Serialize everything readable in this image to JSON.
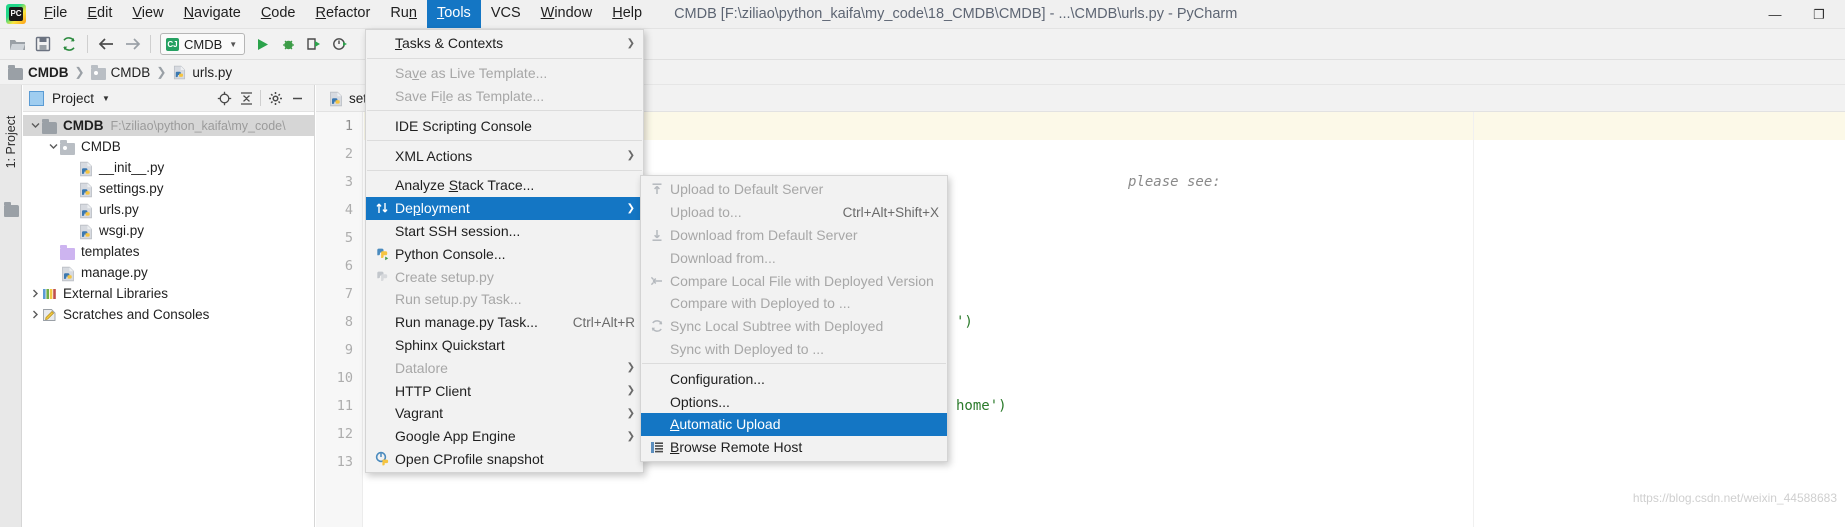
{
  "app": {
    "logo_icon": "pycharm-logo-icon",
    "window_title": "CMDB [F:\\ziliao\\python_kaifa\\my_code\\18_CMDB\\CMDB] - ...\\CMDB\\urls.py - PyCharm",
    "window_controls": {
      "minimize": "—",
      "maximize": "❐",
      "close": "✕"
    }
  },
  "menubar": {
    "items": [
      {
        "label": "File",
        "mnemonic": "F",
        "active": false
      },
      {
        "label": "Edit",
        "mnemonic": "E",
        "active": false
      },
      {
        "label": "View",
        "mnemonic": "V",
        "active": false
      },
      {
        "label": "Navigate",
        "mnemonic": "N",
        "active": false
      },
      {
        "label": "Code",
        "mnemonic": "C",
        "active": false
      },
      {
        "label": "Refactor",
        "mnemonic": "R",
        "active": false
      },
      {
        "label": "Run",
        "mnemonic": "n",
        "active": false
      },
      {
        "label": "Tools",
        "mnemonic": "T",
        "active": true
      },
      {
        "label": "VCS",
        "mnemonic": "",
        "active": false
      },
      {
        "label": "Window",
        "mnemonic": "W",
        "active": false
      },
      {
        "label": "Help",
        "mnemonic": "H",
        "active": false
      }
    ]
  },
  "toolbar": {
    "icons": [
      "open-folder-icon",
      "save-all-icon",
      "sync-refresh-icon",
      "back-arrow-icon",
      "forward-arrow-icon"
    ],
    "run_config": {
      "label": "CMDB",
      "chip": "CJ",
      "dropdown_icon": "chevron-down-icon"
    },
    "right_icons": [
      "run-icon",
      "debug-icon",
      "run-with-coverage-icon",
      "profile-icon"
    ]
  },
  "breadcrumb": {
    "items": [
      {
        "label": "CMDB",
        "icon": "folder-icon",
        "bold": true
      },
      {
        "label": "CMDB",
        "icon": "folder-open-icon",
        "bold": false
      },
      {
        "label": "urls.py",
        "icon": "python-file-icon",
        "bold": false
      }
    ],
    "separator": "❯"
  },
  "left_strip": {
    "tool_window_label": "1: Project",
    "mnemonic": "1",
    "folder_icon": "folder-icon"
  },
  "project_panel": {
    "header": {
      "title": "Project",
      "view_icon": "project-view-icon",
      "dropdown_icon": "chevron-down-icon",
      "locate_icon": "target-crosshair-icon",
      "collapse_icon": "collapse-all-icon",
      "settings_icon": "gear-icon",
      "hide_icon": "minimize-icon"
    },
    "tree": [
      {
        "label": "CMDB",
        "path": "F:\\ziliao\\python_kaifa\\my_code\\",
        "icon": "folder-icon",
        "indent": 0,
        "arrow": "expanded",
        "bold": true,
        "selected": true
      },
      {
        "label": "CMDB",
        "path": "",
        "icon": "folder-open-icon",
        "indent": 1,
        "arrow": "expanded",
        "bold": false,
        "selected": false
      },
      {
        "label": "__init__.py",
        "path": "",
        "icon": "python-file-icon",
        "indent": 2,
        "arrow": "none",
        "bold": false,
        "selected": false
      },
      {
        "label": "settings.py",
        "path": "",
        "icon": "python-file-icon",
        "indent": 2,
        "arrow": "none",
        "bold": false,
        "selected": false
      },
      {
        "label": "urls.py",
        "path": "",
        "icon": "python-file-icon",
        "indent": 2,
        "arrow": "none",
        "bold": false,
        "selected": false
      },
      {
        "label": "wsgi.py",
        "path": "",
        "icon": "python-file-icon",
        "indent": 2,
        "arrow": "none",
        "bold": false,
        "selected": false
      },
      {
        "label": "templates",
        "path": "",
        "icon": "folder-violet-icon",
        "indent": 1,
        "arrow": "none",
        "bold": false,
        "selected": false
      },
      {
        "label": "manage.py",
        "path": "",
        "icon": "python-file-icon",
        "indent": 1,
        "arrow": "none",
        "bold": false,
        "selected": false
      },
      {
        "label": "External Libraries",
        "path": "",
        "icon": "library-icon",
        "indent": 0,
        "arrow": "collapsed",
        "bold": false,
        "selected": false
      },
      {
        "label": "Scratches and Consoles",
        "path": "",
        "icon": "scratches-icon",
        "indent": 0,
        "arrow": "collapsed",
        "bold": false,
        "selected": false
      }
    ]
  },
  "editor": {
    "tab": {
      "label": "sett",
      "icon": "python-file-icon"
    },
    "line_numbers": [
      "1",
      "2",
      "3",
      "4",
      "5",
      "6",
      "7",
      "8",
      "9",
      "10",
      "11",
      "12",
      "13"
    ],
    "current_line": 1,
    "code_lines": [
      {
        "text": "",
        "kind": "plain"
      },
      {
        "text": "",
        "kind": "plain"
      },
      {
        "text": "please see:",
        "kind": "comment"
      },
      {
        "text": "",
        "kind": "plain"
      },
      {
        "text": "",
        "kind": "plain"
      },
      {
        "text": "",
        "kind": "plain"
      },
      {
        "text": "",
        "kind": "plain"
      },
      {
        "text": "')",
        "kind": "string"
      },
      {
        "text": "",
        "kind": "plain"
      },
      {
        "text": "",
        "kind": "plain"
      },
      {
        "text": "home')",
        "kind": "string"
      },
      {
        "text": "",
        "kind": "plain"
      },
      {
        "text": "",
        "kind": "plain"
      }
    ],
    "watermark": "https://blog.csdn.net/weixin_44588683"
  },
  "tools_menu": {
    "items": [
      {
        "label": "Tasks & Contexts",
        "mnemonic": "T",
        "icon": "",
        "shortcut": "",
        "submenu": true,
        "disabled": false,
        "selected": false
      },
      {
        "separator": true
      },
      {
        "label": "Save as Live Template...",
        "mnemonic": "v",
        "icon": "",
        "shortcut": "",
        "submenu": false,
        "disabled": true,
        "selected": false
      },
      {
        "label": "Save File as Template...",
        "mnemonic": "l",
        "icon": "",
        "shortcut": "",
        "submenu": false,
        "disabled": true,
        "selected": false
      },
      {
        "separator": true
      },
      {
        "label": "IDE Scripting Console",
        "mnemonic": "",
        "icon": "",
        "shortcut": "",
        "submenu": false,
        "disabled": false,
        "selected": false
      },
      {
        "separator": true
      },
      {
        "label": "XML Actions",
        "mnemonic": "",
        "icon": "",
        "shortcut": "",
        "submenu": true,
        "disabled": false,
        "selected": false
      },
      {
        "separator": true
      },
      {
        "label": "Analyze Stack Trace...",
        "mnemonic": "S",
        "icon": "",
        "shortcut": "",
        "submenu": false,
        "disabled": false,
        "selected": false
      },
      {
        "label": "Deployment",
        "mnemonic": "p",
        "icon": "deployment-updown-arrows-icon",
        "shortcut": "",
        "submenu": true,
        "disabled": false,
        "selected": true
      },
      {
        "label": "Start SSH session...",
        "mnemonic": "",
        "icon": "",
        "shortcut": "",
        "submenu": false,
        "disabled": false,
        "selected": false
      },
      {
        "label": "Python Console...",
        "mnemonic": "",
        "icon": "python-console-icon",
        "shortcut": "",
        "submenu": false,
        "disabled": false,
        "selected": false
      },
      {
        "label": "Create setup.py",
        "mnemonic": "",
        "icon": "python-setup-icon-grey",
        "shortcut": "",
        "submenu": false,
        "disabled": true,
        "selected": false
      },
      {
        "label": "Run setup.py Task...",
        "mnemonic": "",
        "icon": "",
        "shortcut": "",
        "submenu": false,
        "disabled": true,
        "selected": false
      },
      {
        "label": "Run manage.py Task...",
        "mnemonic": "",
        "icon": "",
        "shortcut": "Ctrl+Alt+R",
        "submenu": false,
        "disabled": false,
        "selected": false
      },
      {
        "label": "Sphinx Quickstart",
        "mnemonic": "",
        "icon": "",
        "shortcut": "",
        "submenu": false,
        "disabled": false,
        "selected": false
      },
      {
        "label": "Datalore",
        "mnemonic": "",
        "icon": "",
        "shortcut": "",
        "submenu": true,
        "disabled": true,
        "selected": false
      },
      {
        "label": "HTTP Client",
        "mnemonic": "",
        "icon": "",
        "shortcut": "",
        "submenu": true,
        "disabled": false,
        "selected": false
      },
      {
        "label": "Vagrant",
        "mnemonic": "",
        "icon": "",
        "shortcut": "",
        "submenu": true,
        "disabled": false,
        "selected": false
      },
      {
        "label": "Google App Engine",
        "mnemonic": "",
        "icon": "",
        "shortcut": "",
        "submenu": true,
        "disabled": false,
        "selected": false
      },
      {
        "label": "Open CProfile snapshot",
        "mnemonic": "",
        "icon": "cprofile-snapshot-icon",
        "shortcut": "",
        "submenu": false,
        "disabled": false,
        "selected": false
      }
    ]
  },
  "deployment_submenu": {
    "items": [
      {
        "label": "Upload to Default Server",
        "mnemonic": "",
        "icon": "upload-arrow-icon",
        "shortcut": "",
        "disabled": true,
        "selected": false
      },
      {
        "label": "Upload to...",
        "mnemonic": "",
        "icon": "",
        "shortcut": "Ctrl+Alt+Shift+X",
        "disabled": true,
        "selected": false
      },
      {
        "label": "Download from Default Server",
        "mnemonic": "",
        "icon": "download-arrow-icon",
        "shortcut": "",
        "disabled": true,
        "selected": false
      },
      {
        "label": "Download from...",
        "mnemonic": "",
        "icon": "",
        "shortcut": "",
        "disabled": true,
        "selected": false
      },
      {
        "label": "Compare Local File with Deployed Version",
        "mnemonic": "",
        "icon": "compare-arrow-icon",
        "shortcut": "",
        "disabled": true,
        "selected": false
      },
      {
        "label": "Compare with Deployed to ...",
        "mnemonic": "",
        "icon": "",
        "shortcut": "",
        "disabled": true,
        "selected": false
      },
      {
        "label": "Sync Local Subtree with Deployed",
        "mnemonic": "",
        "icon": "sync-circular-icon",
        "shortcut": "",
        "disabled": true,
        "selected": false
      },
      {
        "label": "Sync with Deployed to ...",
        "mnemonic": "",
        "icon": "",
        "shortcut": "",
        "disabled": true,
        "selected": false
      },
      {
        "separator": true
      },
      {
        "label": "Configuration...",
        "mnemonic": "",
        "icon": "",
        "shortcut": "",
        "disabled": false,
        "selected": false
      },
      {
        "label": "Options...",
        "mnemonic": "",
        "icon": "",
        "shortcut": "",
        "disabled": false,
        "selected": false
      },
      {
        "label": "Automatic Upload",
        "mnemonic": "A",
        "icon": "",
        "shortcut": "",
        "disabled": false,
        "selected": true
      },
      {
        "label": "Browse Remote Host",
        "mnemonic": "B",
        "icon": "remote-host-list-icon",
        "shortcut": "",
        "disabled": false,
        "selected": false
      }
    ]
  },
  "colors": {
    "accent_selected": "#1476c4",
    "menu_bg": "#f2f2f2",
    "panel_bg": "#ffffff",
    "caret_line": "#fcf9e8",
    "disabled_text": "#a7a7a7"
  }
}
